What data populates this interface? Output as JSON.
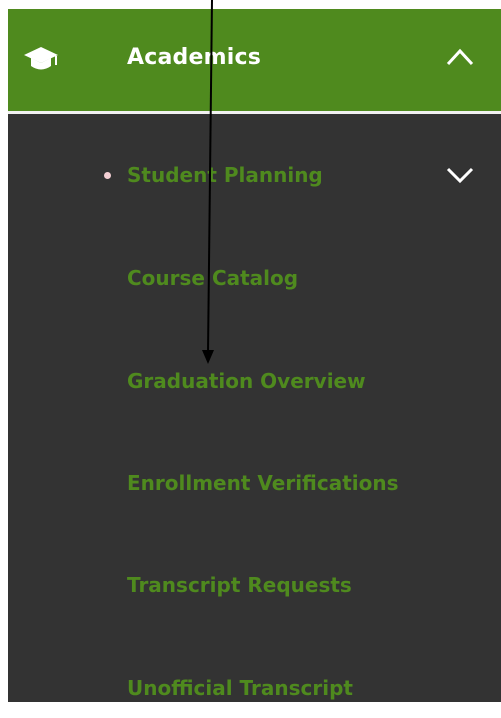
{
  "menu": {
    "header": {
      "title": "Academics",
      "icon": "graduation-cap-icon",
      "chevron_icon": "chevron-up-icon",
      "background_color": "#4f8a1e"
    },
    "items": [
      {
        "label": "Student Planning",
        "active": true,
        "has_submenu": true,
        "chevron_icon": "chevron-down-icon"
      },
      {
        "label": "Course Catalog"
      },
      {
        "label": "Graduation Overview"
      },
      {
        "label": "Enrollment Verifications"
      },
      {
        "label": "Transcript Requests"
      },
      {
        "label": "Unofficial Transcript"
      }
    ],
    "colors": {
      "panel_background": "#333333",
      "item_text": "#4f8a1e",
      "active_bullet": "#f3cfd4",
      "header_text": "#ffffff"
    }
  },
  "annotation": {
    "arrow": "arrow-down-icon",
    "color": "#000000"
  }
}
